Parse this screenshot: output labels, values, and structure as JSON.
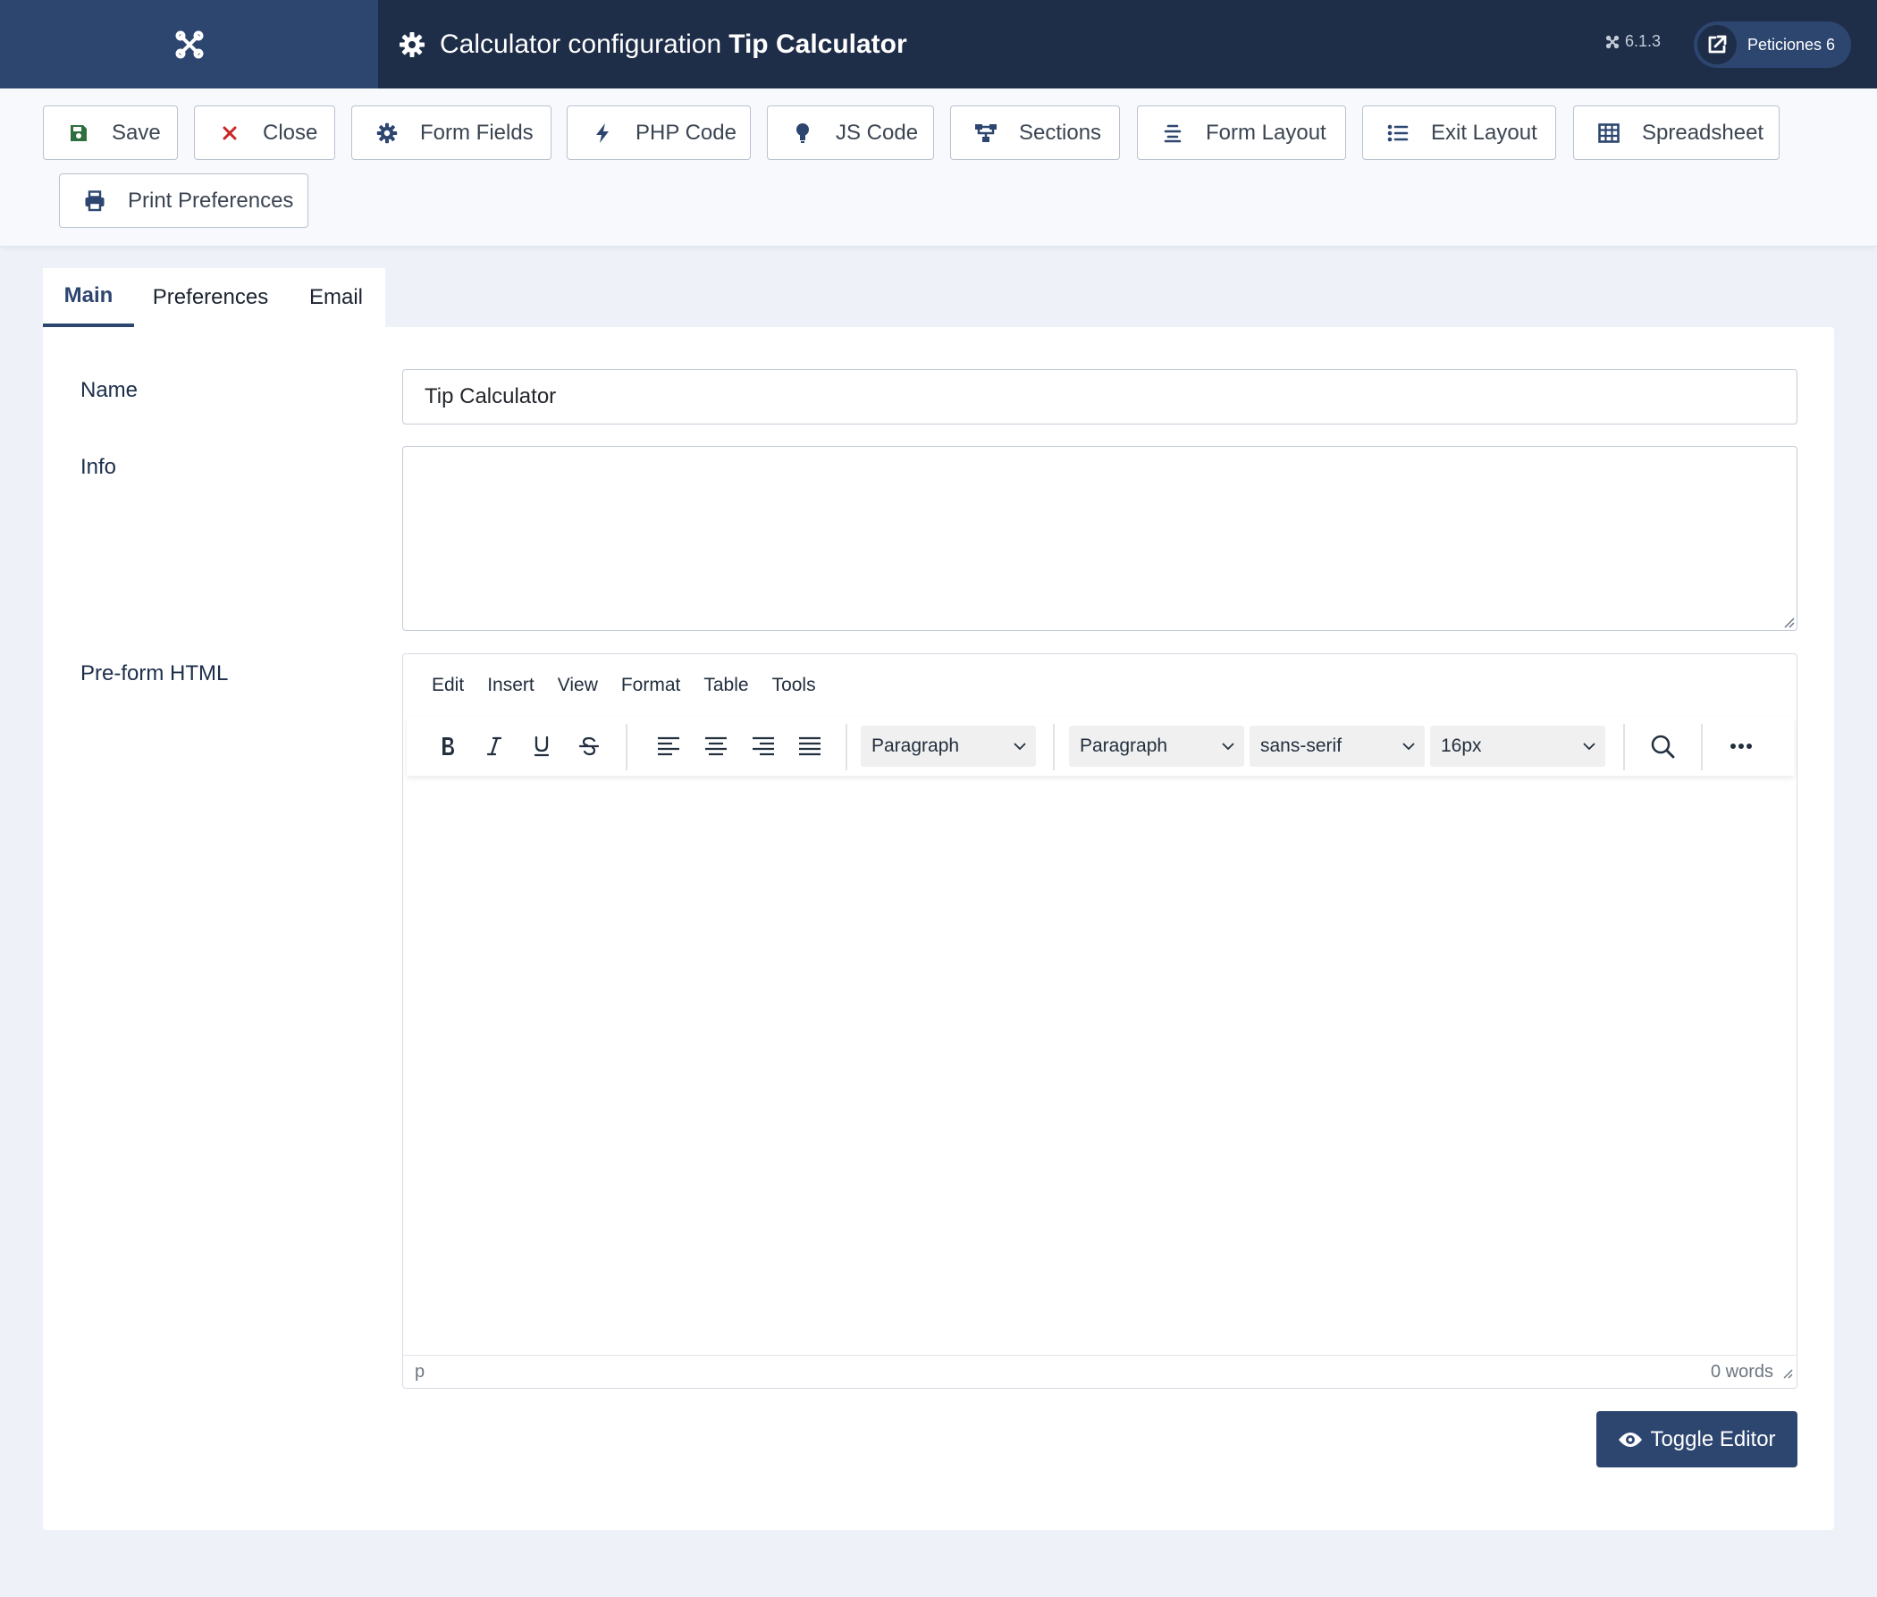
{
  "header": {
    "title_prefix": "Calculator configuration",
    "title_name": "Tip Calculator",
    "version": "6.1.3",
    "peticiones_label": "Peticiones 6"
  },
  "toolbar": {
    "buttons": [
      {
        "label": "Save",
        "icon": "save-icon",
        "color": "#2f6f3e"
      },
      {
        "label": "Close",
        "icon": "close-icon",
        "color": "#c52827"
      },
      {
        "label": "Form Fields",
        "icon": "gear-icon",
        "color": "#2d4670"
      },
      {
        "label": "PHP Code",
        "icon": "bolt-icon",
        "color": "#2d4670"
      },
      {
        "label": "JS Code",
        "icon": "lightbulb-icon",
        "color": "#2d4670"
      },
      {
        "label": "Sections",
        "icon": "sitemap-icon",
        "color": "#2d4670"
      },
      {
        "label": "Form Layout",
        "icon": "align-center-icon",
        "color": "#2d4670"
      },
      {
        "label": "Exit Layout",
        "icon": "list-icon",
        "color": "#2d4670"
      },
      {
        "label": "Spreadsheet",
        "icon": "table-icon",
        "color": "#2d4670"
      },
      {
        "label": "Print Preferences",
        "icon": "print-icon",
        "color": "#2d4670"
      }
    ]
  },
  "tabs": [
    {
      "label": "Main",
      "active": true
    },
    {
      "label": "Preferences",
      "active": false
    },
    {
      "label": "Email",
      "active": false
    }
  ],
  "form": {
    "name_label": "Name",
    "name_value": "Tip Calculator",
    "info_label": "Info",
    "info_value": "",
    "preform_label": "Pre-form HTML"
  },
  "editor": {
    "menu": [
      "Edit",
      "Insert",
      "View",
      "Format",
      "Table",
      "Tools"
    ],
    "block_format": "Paragraph",
    "styles": "Paragraph",
    "font_family": "sans-serif",
    "font_size": "16px",
    "status_path": "p",
    "word_count": "0 words"
  },
  "toggle_editor_label": "Toggle Editor",
  "colors": {
    "header_bg": "#1e2d48",
    "accent": "#2d4670",
    "page_bg": "#eef2f8"
  }
}
